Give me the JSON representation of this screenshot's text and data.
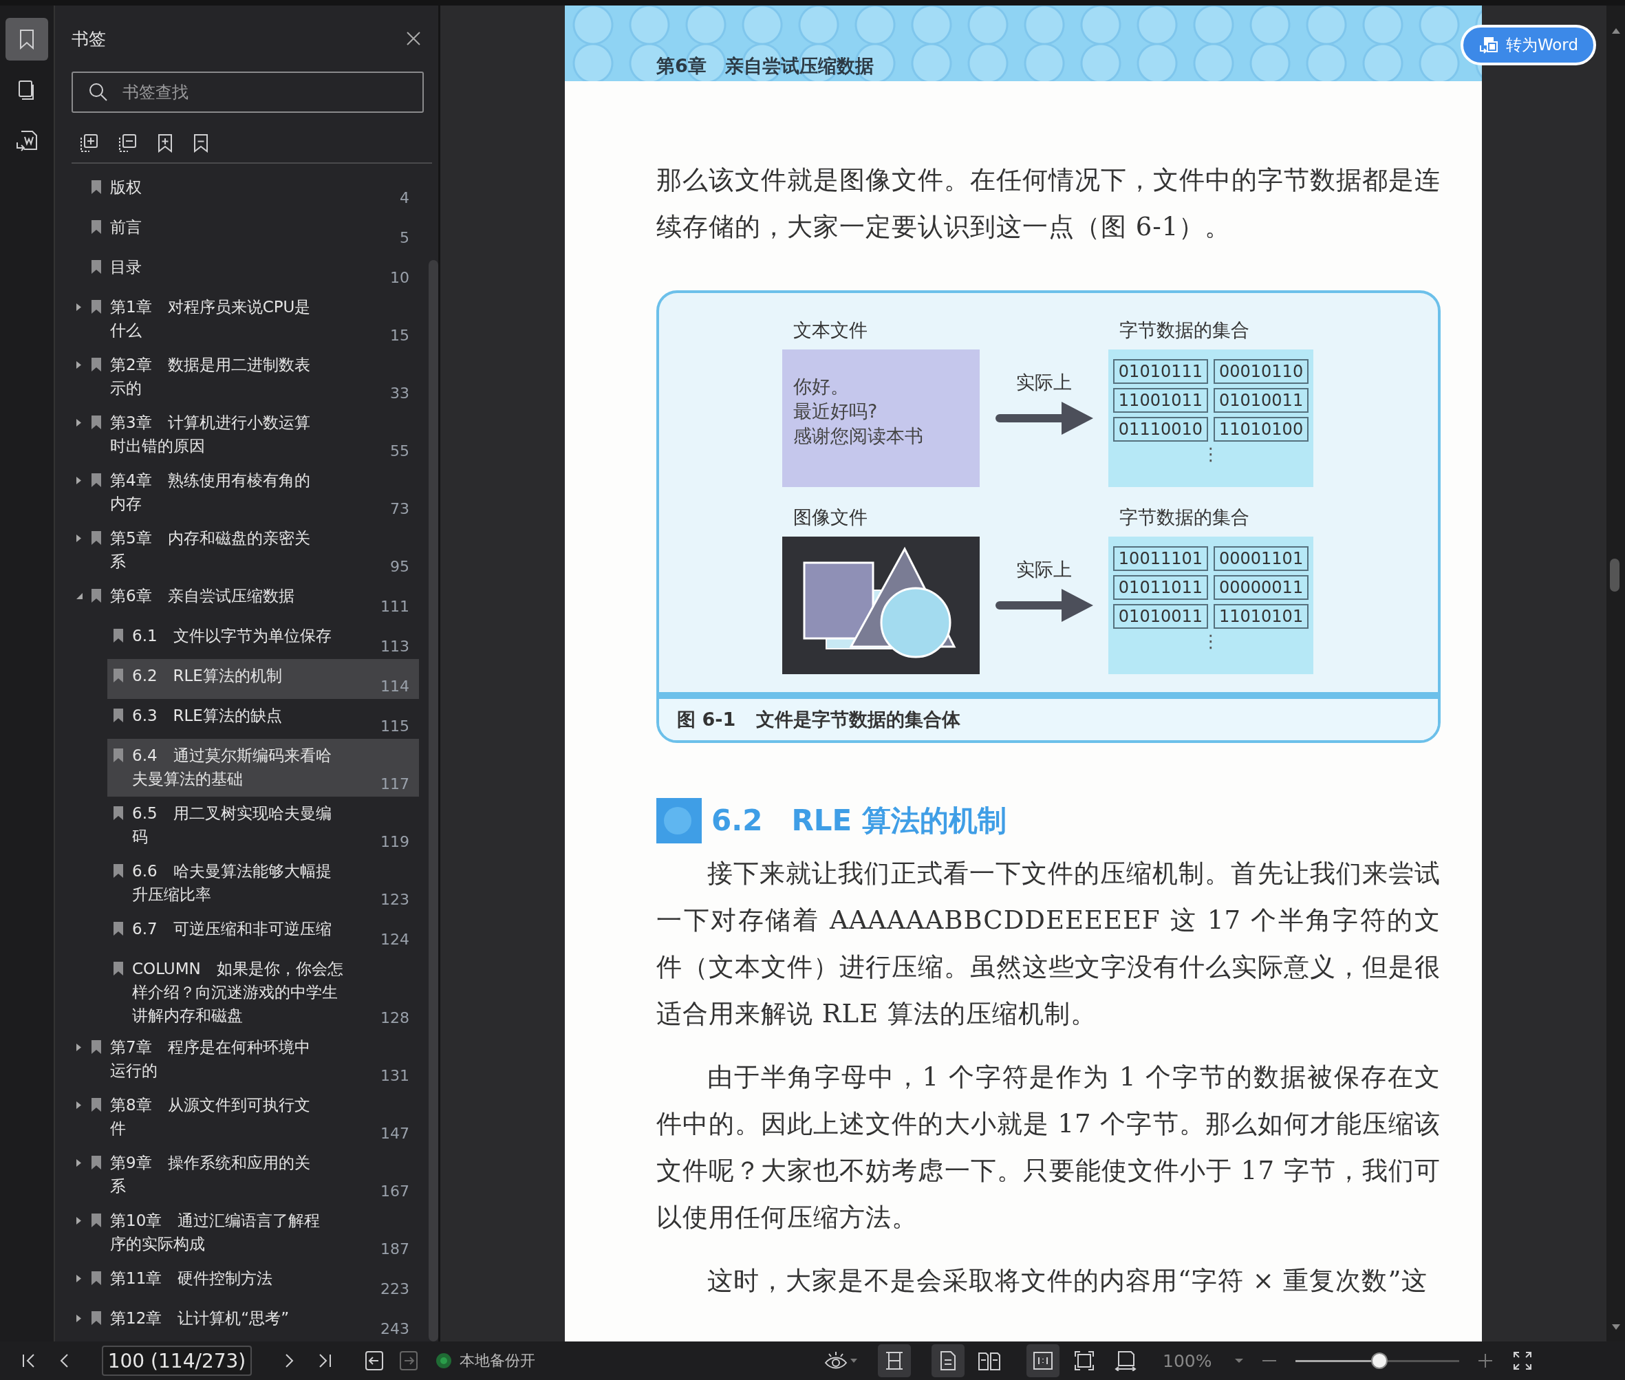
{
  "rail": [
    {
      "kind": "bookmarks",
      "selected": true
    },
    {
      "kind": "pages",
      "selected": false
    },
    {
      "kind": "convert",
      "selected": false
    }
  ],
  "sidebar": {
    "title": "书签",
    "search": {
      "placeholder": "书签查找"
    },
    "items": [
      {
        "kind": "entry",
        "title": "版权",
        "page": "4",
        "selected": false
      },
      {
        "kind": "entry",
        "title": "前言",
        "page": "5",
        "selected": false
      },
      {
        "kind": "entry",
        "title": "目录",
        "page": "10",
        "selected": false
      },
      {
        "kind": "chapter",
        "title": "第1章　对程序员来说CPU是什么",
        "page": "15",
        "expanded": false,
        "selected": false
      },
      {
        "kind": "chapter",
        "title": "第2章　数据是用二进制数表示的",
        "page": "33",
        "expanded": false,
        "selected": false
      },
      {
        "kind": "chapter",
        "title": "第3章　计算机进行小数运算时出错的原因",
        "page": "55",
        "expanded": false,
        "selected": false
      },
      {
        "kind": "chapter",
        "title": "第4章　熟练使用有棱有角的内存",
        "page": "73",
        "expanded": false,
        "selected": false
      },
      {
        "kind": "chapter",
        "title": "第5章　内存和磁盘的亲密关系",
        "page": "95",
        "expanded": false,
        "selected": false
      },
      {
        "kind": "chapter",
        "title": "第6章　亲自尝试压缩数据",
        "page": "111",
        "expanded": true,
        "selected": false,
        "children": [
          {
            "kind": "entry",
            "title": "6.1　文件以字节为单位保存",
            "page": "113",
            "selected": false
          },
          {
            "kind": "entry",
            "title": "6.2　RLE算法的机制",
            "page": "114",
            "selected": true
          },
          {
            "kind": "entry",
            "title": "6.3　RLE算法的缺点",
            "page": "115",
            "selected": false
          },
          {
            "kind": "entry",
            "title": "6.4　通过莫尔斯编码来看哈夫曼算法的基础",
            "page": "117",
            "selected": false,
            "hovered": true
          },
          {
            "kind": "entry",
            "title": "6.5　用二叉树实现哈夫曼编码",
            "page": "119",
            "selected": false
          },
          {
            "kind": "entry",
            "title": "6.6　哈夫曼算法能够大幅提升压缩比率",
            "page": "123",
            "selected": false
          },
          {
            "kind": "entry",
            "title": "6.7　可逆压缩和非可逆压缩",
            "page": "124",
            "selected": false
          },
          {
            "kind": "entry",
            "title": "COLUMN　如果是你，你会怎样介绍？向沉迷游戏的中学生讲解内存和磁盘",
            "page": "128",
            "selected": false
          }
        ]
      },
      {
        "kind": "chapter",
        "title": "第7章　程序是在何种环境中运行的",
        "page": "131",
        "expanded": false,
        "selected": false
      },
      {
        "kind": "chapter",
        "title": "第8章　从源文件到可执行文件",
        "page": "147",
        "expanded": false,
        "selected": false
      },
      {
        "kind": "chapter",
        "title": "第9章　操作系统和应用的关系",
        "page": "167",
        "expanded": false,
        "selected": false
      },
      {
        "kind": "chapter",
        "title": "第10章　通过汇编语言了解程序的实际构成",
        "page": "187",
        "expanded": false,
        "selected": false
      },
      {
        "kind": "chapter",
        "title": "第11章　硬件控制方法",
        "page": "223",
        "expanded": false,
        "selected": false
      },
      {
        "kind": "chapter",
        "title": "第12章　让计算机“思考”",
        "page": "243",
        "expanded": false,
        "selected": false
      }
    ]
  },
  "document": {
    "header": "第6章　亲自尝试压缩数据",
    "blocks": [
      {
        "kind": "paragraph",
        "indent": false,
        "text": "那么该文件就是图像文件。在任何情况下，文件中的字节数据都是连续存储的，大家一定要认识到这一点（图 6-1）。"
      },
      {
        "kind": "figure",
        "number": "图 6-1",
        "caption": "文件是字节数据的集合体",
        "rows": [
          {
            "kind": "text",
            "label": "文本文件",
            "lines": [
              "你好。",
              "最近好吗?",
              "感谢您阅读本书"
            ],
            "arrow_label": "实际上",
            "bytes_label": "字节数据的集合",
            "bytes": [
              "01010111",
              "00010110",
              "11001011",
              "01010011",
              "01110010",
              "11010100"
            ],
            "more": "⋮"
          },
          {
            "kind": "image",
            "label": "图像文件",
            "arrow_label": "实际上",
            "bytes_label": "字节数据的集合",
            "bytes": [
              "10011101",
              "00001101",
              "01011011",
              "00000011",
              "01010011",
              "11010101"
            ],
            "more": "⋮"
          }
        ]
      },
      {
        "kind": "heading",
        "text": "6.2　RLE 算法的机制"
      },
      {
        "kind": "paragraph",
        "indent": true,
        "text": "接下来就让我们正式看一下文件的压缩机制。首先让我们来尝试一下对存储着 AAAAAABBCDDEEEEEF 这 17 个半角字符的文件（文本文件）进行压缩。虽然这些文字没有什么实际意义，但是很适合用来解说 RLE 算法的压缩机制。"
      },
      {
        "kind": "paragraph",
        "indent": true,
        "text": "由于半角字母中，1 个字符是作为 1 个字节的数据被保存在文件中的。因此上述文件的大小就是 17 个字节。那么如何才能压缩该文件呢？大家也不妨考虑一下。只要能使文件小于 17 字节，我们可以使用任何压缩方法。"
      },
      {
        "kind": "paragraph",
        "indent": true,
        "text": "这时，大家是不是会采取将文件的内容用“字符 × 重复次数”这"
      }
    ]
  },
  "convert_button": {
    "label": "转为Word"
  },
  "toolbar": {
    "nav": [
      {
        "kind": "first"
      },
      {
        "kind": "prev"
      }
    ],
    "page_field": "100 (114/273)",
    "nav2": [
      {
        "kind": "next"
      },
      {
        "kind": "last"
      }
    ],
    "history": [
      {
        "kind": "back",
        "disabled": false
      },
      {
        "kind": "forward",
        "disabled": true
      }
    ],
    "backup": {
      "label": "本地备份开",
      "on": true
    },
    "view_groups": [
      [
        {
          "kind": "eye",
          "selected": false
        }
      ],
      [
        {
          "kind": "scroll",
          "selected": true
        }
      ],
      [
        {
          "kind": "single",
          "selected": true
        },
        {
          "kind": "double",
          "selected": false
        }
      ],
      [
        {
          "kind": "actual",
          "selected": true
        },
        {
          "kind": "fit-page",
          "selected": false
        },
        {
          "kind": "fit-width",
          "selected": false
        }
      ]
    ],
    "zoom": {
      "value": "100%",
      "level": 0.51
    }
  }
}
